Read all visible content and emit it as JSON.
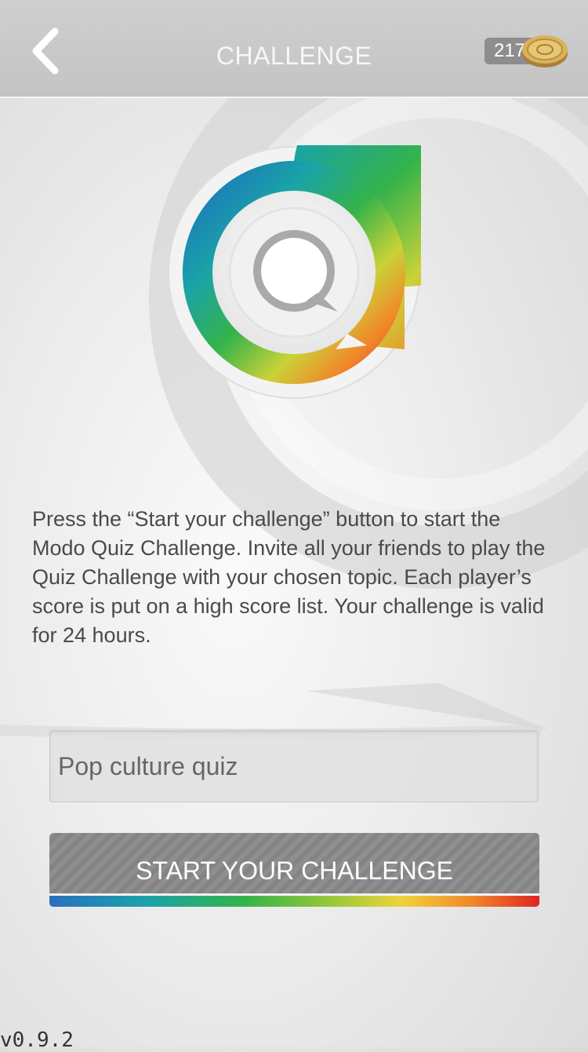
{
  "header": {
    "title": "CHALLENGE",
    "coin_count": "217"
  },
  "description": "Press the “Start your challenge” button to start the Modo Quiz Challenge. Invite all your friends to play the Quiz Challenge with your chosen topic. Each player’s score is put on a high score list. Your challenge is valid for 24 hours.",
  "topic_field": {
    "value": "Pop culture quiz"
  },
  "start_button": {
    "label": "START YOUR CHALLENGE"
  },
  "version": "v0.9.2",
  "icons": {
    "back": "chevron-left-icon",
    "coin": "coin-icon",
    "logo": "quiz-logo-icon"
  },
  "colors": {
    "header_bg": "#c8c8c8",
    "button_bg": "#8a8a8a",
    "rainbow": [
      "#2a6fbf",
      "#1aa3a8",
      "#35b34a",
      "#9bc83a",
      "#f0d23a",
      "#f08a2a",
      "#e02424"
    ]
  }
}
